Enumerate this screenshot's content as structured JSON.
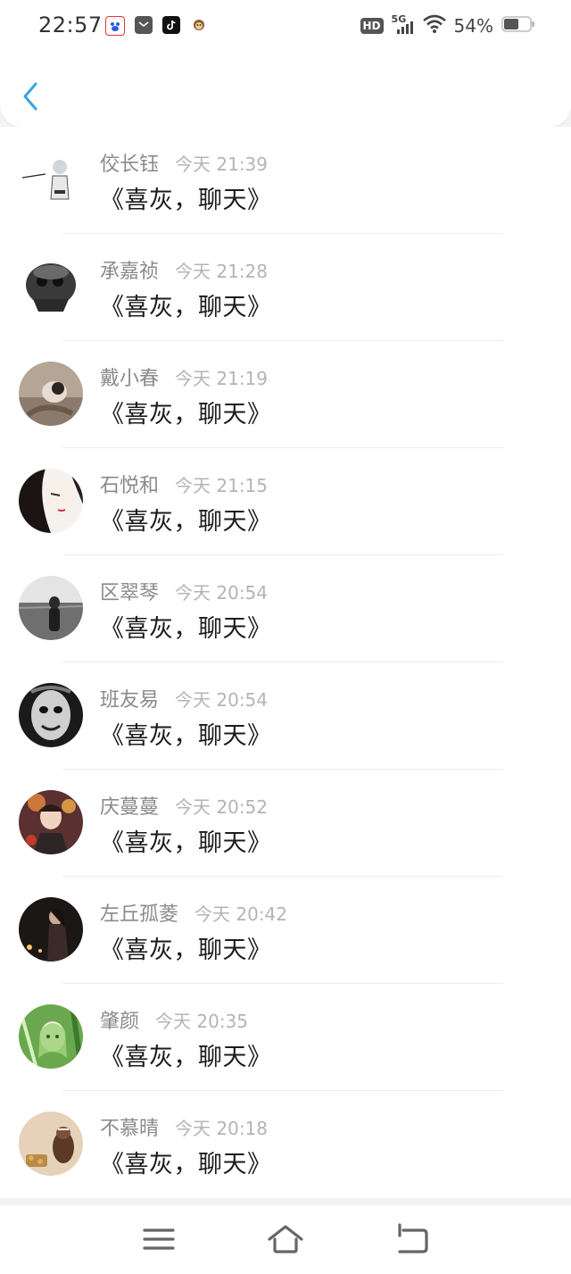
{
  "status_bar": {
    "time": "22:57",
    "network_badge": "HD",
    "network_type": "5G",
    "battery": "54%",
    "icons": [
      "baidu-app-icon",
      "mail-app-icon",
      "tiktok-app-icon",
      "monkey-app-icon",
      "signal-icon",
      "wifi-icon",
      "battery-icon"
    ]
  },
  "header": {
    "back_icon": "chevron-left-icon"
  },
  "messages": [
    {
      "name": "佼长钰",
      "time": "今天 21:39",
      "text": "《喜灰，聊天》"
    },
    {
      "name": "承嘉祯",
      "time": "今天 21:28",
      "text": "《喜灰，聊天》"
    },
    {
      "name": "戴小春",
      "time": "今天 21:19",
      "text": "《喜灰，聊天》"
    },
    {
      "name": "石悦和",
      "time": "今天 21:15",
      "text": "《喜灰，聊天》"
    },
    {
      "name": "区翠琴",
      "time": "今天 20:54",
      "text": "《喜灰，聊天》"
    },
    {
      "name": "班友易",
      "time": "今天 20:54",
      "text": "《喜灰，聊天》"
    },
    {
      "name": "庆蔓蔓",
      "time": "今天 20:52",
      "text": "《喜灰，聊天》"
    },
    {
      "name": "左丘孤菱",
      "time": "今天 20:42",
      "text": "《喜灰，聊天》"
    },
    {
      "name": "肇颜",
      "time": "今天 20:35",
      "text": "《喜灰，聊天》"
    },
    {
      "name": "不慕晴",
      "time": "今天 20:18",
      "text": "《喜灰，聊天》"
    }
  ],
  "nav_bar": {
    "icons": [
      "menu-icon",
      "home-icon",
      "back-icon"
    ]
  }
}
